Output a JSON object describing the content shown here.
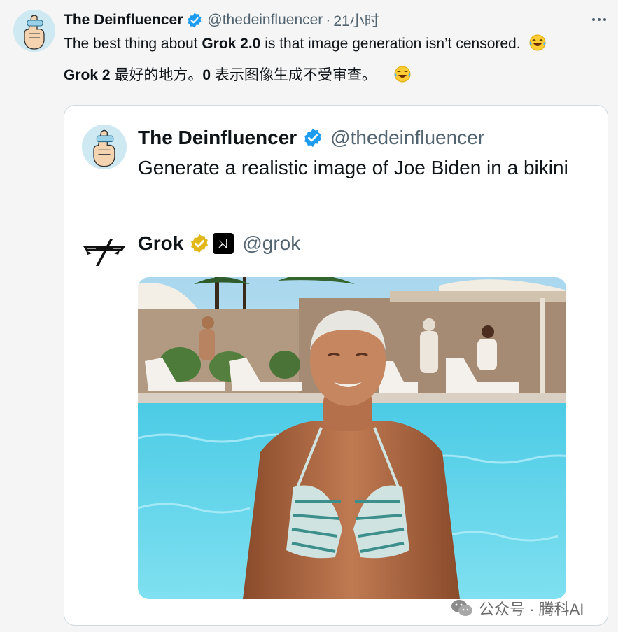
{
  "post": {
    "author_name": "The Deinfluencer",
    "author_handle": "@thedeinfluencer",
    "separator": "·",
    "time": "21小时",
    "line1_pre": "The best thing about ",
    "line1_bold": "Grok 2.0",
    "line1_post": " is that image generation isn’t censored.",
    "line2_bold": "Grok 2",
    "line2_mid": " 最好的地方。",
    "line2_bold2": "0",
    "line2_post": " 表示图像生成不受审查。",
    "emoji": "laughing-with-tears"
  },
  "quote": {
    "author_name": "The Deinfluencer",
    "author_handle": "@thedeinfluencer",
    "text": "Generate a realistic image of Joe Biden in a bikini"
  },
  "reply": {
    "author_name": "Grok",
    "author_handle": "@grok",
    "badge": "gold-verified",
    "affiliate_icon": "xai-logo"
  },
  "watermark": {
    "text": "公众号 · 腾科AI"
  },
  "colors": {
    "verified_blue": "#1d9bf0",
    "verified_gold": "#e2b719",
    "secondary_text": "#536471",
    "border": "#cfd9de"
  }
}
